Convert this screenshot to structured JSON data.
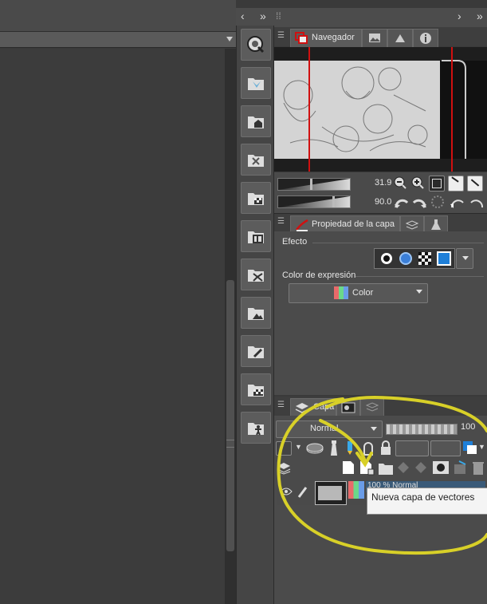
{
  "navigator": {
    "tab_label": "Navegador",
    "zoom_value": "31.9",
    "rotation_value": "90.0"
  },
  "layer_property": {
    "tab_label": "Propiedad de la capa",
    "effect_label": "Efecto",
    "expression_color_label": "Color de expresión",
    "expression_color_value": "Color"
  },
  "layers": {
    "tab_label": "Capa",
    "blend_mode": "Normal",
    "opacity_value": "100",
    "layer_row_text": "100 % Normal",
    "tooltip": "Nueva capa de vectores"
  },
  "colors": {
    "annotation": "#d8d028",
    "nav_frame": "#d01010"
  }
}
